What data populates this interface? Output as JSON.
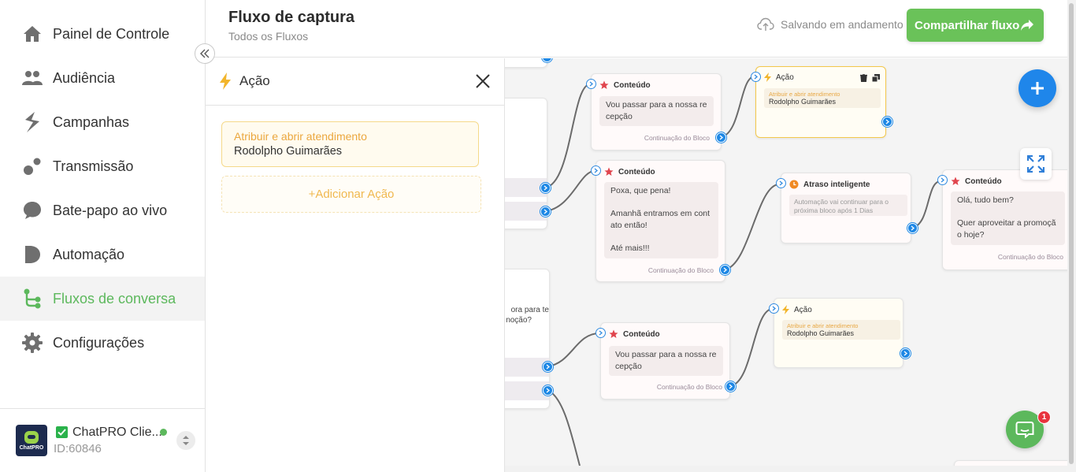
{
  "sidebar": {
    "items": [
      {
        "label": "Painel de Controle",
        "icon": "home-icon"
      },
      {
        "label": "Audiência",
        "icon": "people-icon"
      },
      {
        "label": "Campanhas",
        "icon": "campaign-icon"
      },
      {
        "label": "Transmissão",
        "icon": "broadcast-icon"
      },
      {
        "label": "Bate-papo ao vivo",
        "icon": "chat-bubble-icon"
      },
      {
        "label": "Automação",
        "icon": "automation-icon"
      },
      {
        "label": "Fluxos de conversa",
        "icon": "flow-icon",
        "active": true
      },
      {
        "label": "Configurações",
        "icon": "gear-icon"
      }
    ],
    "account": {
      "name": "ChatPRO Clie...",
      "id": "ID:60846",
      "logo_text": "ChatPRO",
      "status_color": "#5cb85c"
    }
  },
  "header": {
    "title": "Fluxo de captura",
    "breadcrumb": "Todos os Fluxos",
    "saving": "Salvando em andamento",
    "share_label": "Compartilhar fluxo"
  },
  "panel": {
    "title": "Ação",
    "action_type": "Atribuir e abrir atendimento",
    "action_value": "Rodolpho Guimarães",
    "add_action": "+Adicionar Ação"
  },
  "canvas": {
    "left_partial_text_1": "ora para te",
    "left_partial_text_2": "noção?",
    "node_content_1": {
      "title": "Conteúdo",
      "message": "Vou passar para a nossa re\ncepção",
      "footer": "Continuação do Bloco"
    },
    "node_action_1": {
      "title": "Ação",
      "action_type": "Atribuir e abrir atendimento",
      "action_value": "Rodolpho Guimarães"
    },
    "node_content_2": {
      "title": "Conteúdo",
      "message": "Poxa, que pena!\n\nAmanhã entramos em cont\nato então!\n\nAté mais!!!",
      "footer": "Continuação do Bloco"
    },
    "node_delay": {
      "title": "Atraso inteligente",
      "note": "Automação vai continuar para o\npróxima bloco após 1 Dias"
    },
    "node_content_3": {
      "title": "Conteúdo",
      "message": "Olá, tudo bem?\n\nQuer aproveitar a promoçã\no hoje?",
      "footer": "Continuação do Bloco"
    },
    "node_content_4": {
      "title": "Conteúdo",
      "message": "Vou passar para a nossa re\ncepção",
      "footer": "Continuação do Bloco"
    },
    "node_action_2": {
      "title": "Ação",
      "action_type": "Atribuir e abrir atendimento",
      "action_value": "Rodolpho Guimarães"
    }
  },
  "chat_widget": {
    "badge": "1"
  },
  "colors": {
    "accent_green": "#5cb85c",
    "port_blue": "#1e88e5",
    "action_orange": "#eba73e"
  }
}
